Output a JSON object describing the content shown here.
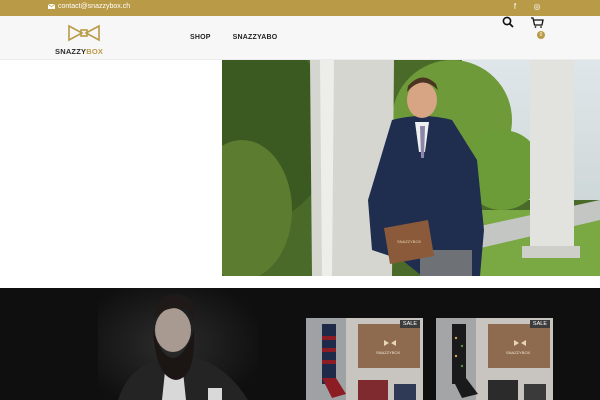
{
  "topbar": {
    "email": "contact@snazzybox.ch",
    "social": {
      "facebook": "f",
      "instagram": "◎"
    }
  },
  "header": {
    "logo": {
      "part1": "SNAZZY",
      "part2": "BOX"
    },
    "nav": [
      {
        "label": "SHOP"
      },
      {
        "label": "SNAZZYABO"
      }
    ],
    "cart_count": "0"
  },
  "hero": {
    "box_label": "SNAZZYBOX"
  },
  "products": [
    {
      "badge": "SALE",
      "box_label": "SNAZZYBOX"
    },
    {
      "badge": "SALE",
      "box_label": "SNAZZYBOX"
    }
  ],
  "colors": {
    "gold": "#b99a47",
    "dark": "#0f0f0f",
    "header_bg": "#f7f7f7"
  }
}
